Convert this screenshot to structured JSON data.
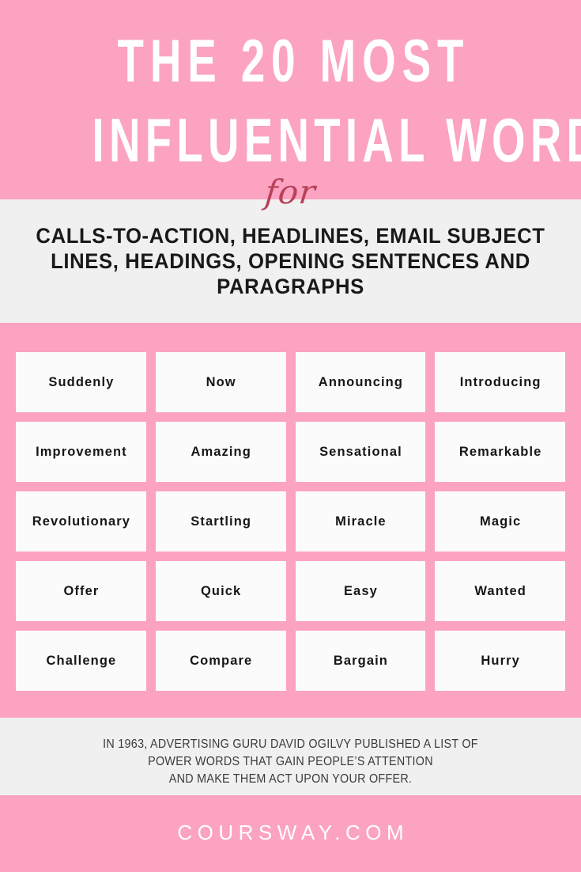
{
  "colors": {
    "pink": "#fba3c0",
    "light_grey": "#f1f0f0",
    "card_white": "#fbfbfb",
    "script_rose": "#b8415a",
    "text_dark": "#161616",
    "note_grey": "#3b3b3b"
  },
  "header": {
    "title_line_1": "THE 20 MOST",
    "title_line_2": "INFLUENTIAL WORDS",
    "connector": "for"
  },
  "subtitle": {
    "text": "CALLS-TO-ACTION, HEADLINES, EMAIL SUBJECT LINES, HEADINGS, OPENING SENTENCES AND PARAGRAPHS"
  },
  "word_grid": {
    "columns": 4,
    "rows": 5,
    "words": [
      "Suddenly",
      "Now",
      "Announcing",
      "Introducing",
      "Improvement",
      "Amazing",
      "Sensational",
      "Remarkable",
      "Revolutionary",
      "Startling",
      "Miracle",
      "Magic",
      "Offer",
      "Quick",
      "Easy",
      "Wanted",
      "Challenge",
      "Compare",
      "Bargain",
      "Hurry"
    ]
  },
  "footnote": {
    "line_1": "IN 1963, ADVERTISING GURU DAVID OGILVY PUBLISHED A LIST OF",
    "line_2": "POWER WORDS THAT GAIN PEOPLE’S ATTENTION",
    "line_3": "AND MAKE THEM ACT UPON YOUR OFFER."
  },
  "brand": {
    "url": "COURSWAY.COM"
  }
}
